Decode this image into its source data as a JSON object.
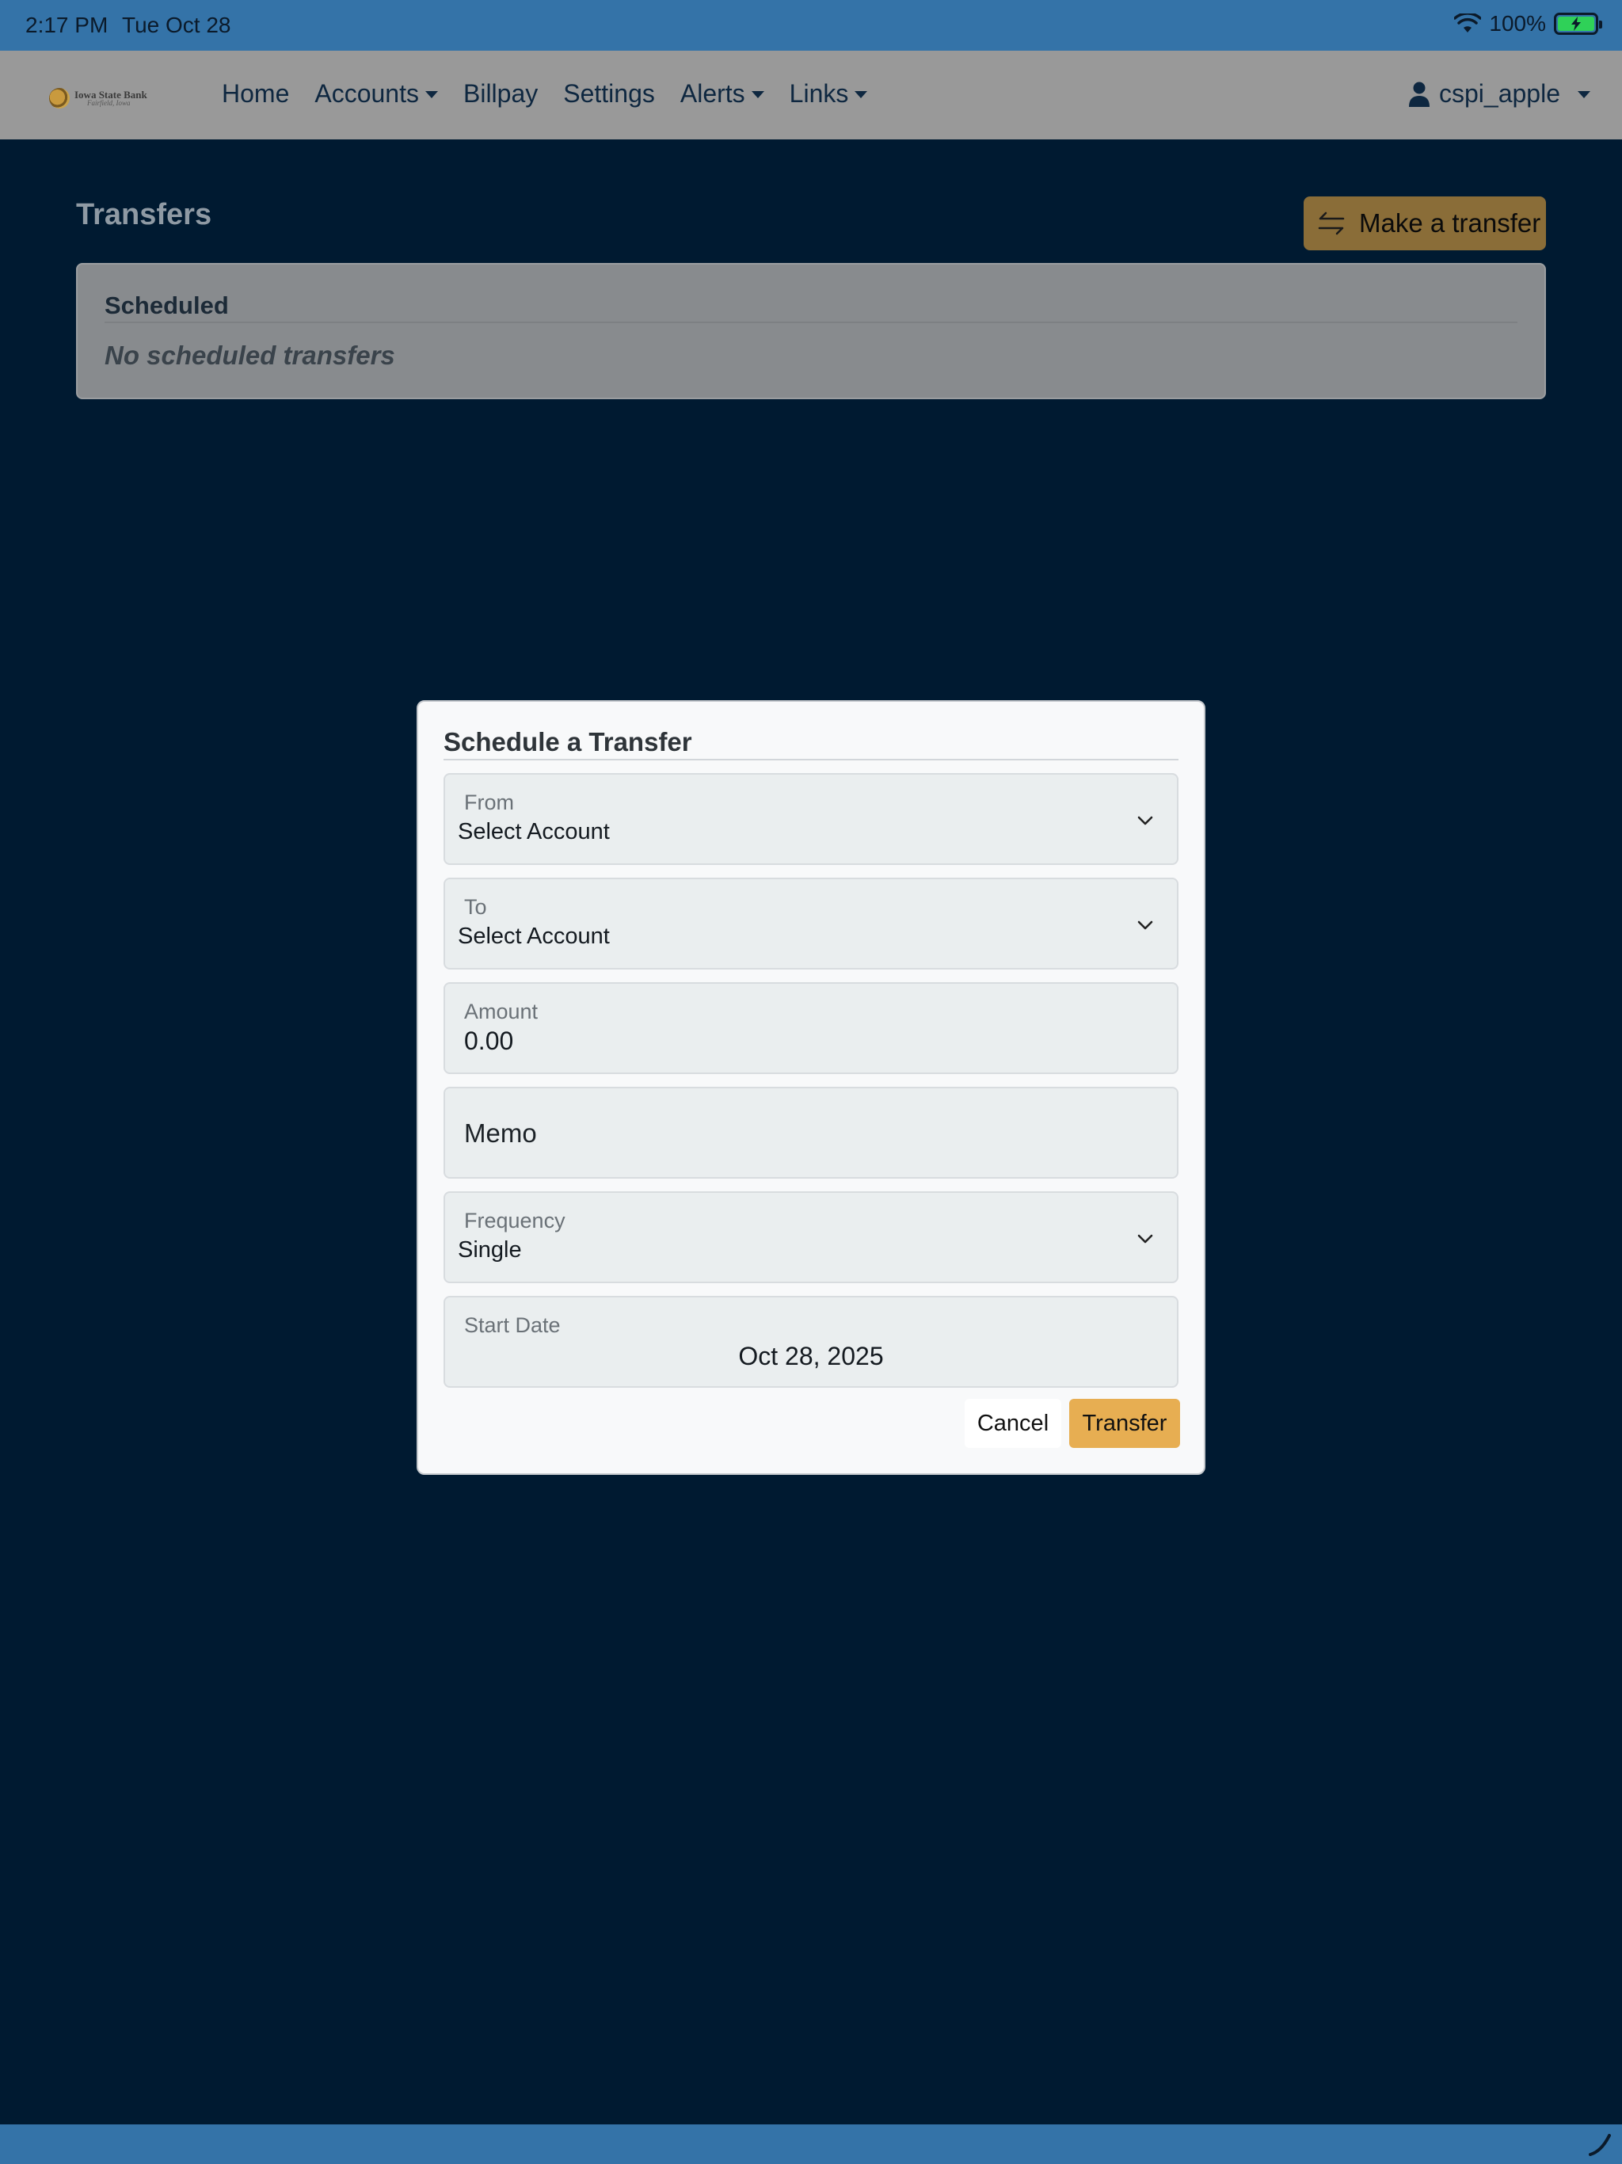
{
  "status_bar": {
    "time": "2:17 PM",
    "date": "Tue Oct 28",
    "battery": "100%"
  },
  "navbar": {
    "logo": {
      "line1": "Iowa State Bank",
      "line2": "Fairfield, Iowa"
    },
    "items": [
      {
        "label": "Home",
        "dropdown": false
      },
      {
        "label": "Accounts",
        "dropdown": true
      },
      {
        "label": "Billpay",
        "dropdown": false
      },
      {
        "label": "Settings",
        "dropdown": false
      },
      {
        "label": "Alerts",
        "dropdown": true
      },
      {
        "label": "Links",
        "dropdown": true
      }
    ],
    "user": "cspi_apple"
  },
  "page": {
    "title": "Transfers",
    "make_transfer_label": "Make a transfer",
    "scheduled": {
      "heading": "Scheduled",
      "empty_text": "No scheduled transfers"
    }
  },
  "modal": {
    "title": "Schedule a Transfer",
    "from": {
      "label": "From",
      "value": "Select Account"
    },
    "to": {
      "label": "To",
      "value": "Select Account"
    },
    "amount": {
      "label": "Amount",
      "value": "0.00"
    },
    "memo": {
      "placeholder": "Memo"
    },
    "frequency": {
      "label": "Frequency",
      "value": "Single"
    },
    "start_date": {
      "label": "Start Date",
      "value": "Oct 28, 2025"
    },
    "cancel_label": "Cancel",
    "transfer_label": "Transfer"
  },
  "colors": {
    "accent": "#e7ae52",
    "statusbar": "#3473a8",
    "backdrop": "#001a31"
  }
}
